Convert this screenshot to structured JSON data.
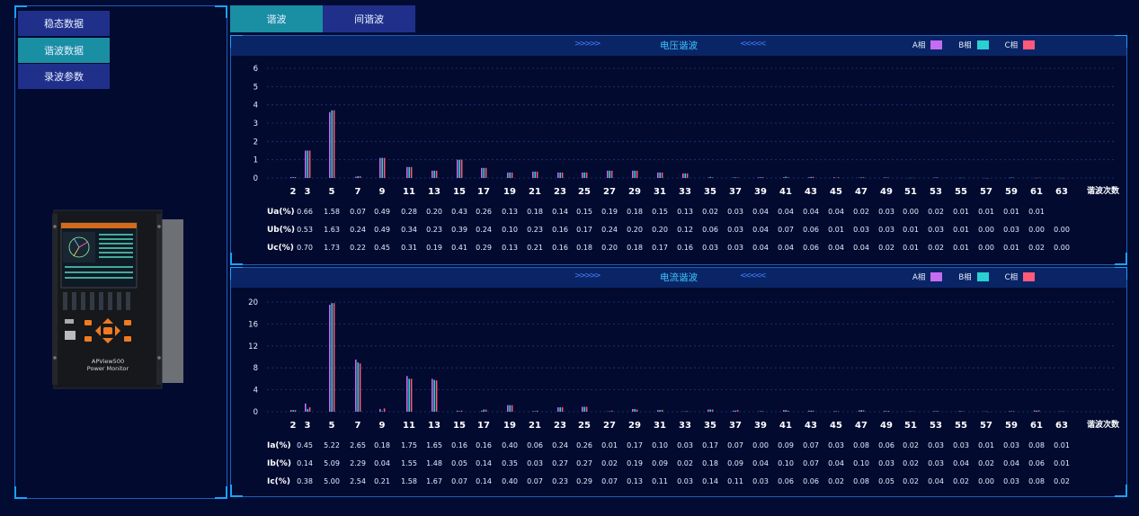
{
  "menu": {
    "items": [
      {
        "label": "稳态数据",
        "active": false
      },
      {
        "label": "谐波数据",
        "active": true
      },
      {
        "label": "录波参数",
        "active": false
      }
    ]
  },
  "device": {
    "line1": "APView500",
    "line2": "Power Monitor"
  },
  "tabs": [
    {
      "label": "谐波",
      "active": true
    },
    {
      "label": "间谐波",
      "active": false
    }
  ],
  "colors": {
    "phase_a": "#c66cf2",
    "phase_b": "#29d0d2",
    "phase_c": "#ff5a7a",
    "accent": "#3ec6ff"
  },
  "voltage": {
    "title": "电压谐波",
    "legend": [
      "A相",
      "B相",
      "C相"
    ],
    "order_label": "谐波次数",
    "rows": [
      {
        "label": "Ua(%)",
        "values": [
          "0.66",
          "1.58",
          "0.07",
          "0.49",
          "0.28",
          "0.20",
          "0.43",
          "0.26",
          "0.13",
          "0.18",
          "0.14",
          "0.15",
          "0.19",
          "0.18",
          "0.15",
          "0.13",
          "0.02",
          "0.03",
          "0.04",
          "0.04",
          "0.04",
          "0.04",
          "0.02",
          "0.03",
          "0.00",
          "0.02",
          "0.01",
          "0.01",
          "0.01",
          "0.01"
        ]
      },
      {
        "label": "Ub(%)",
        "values": [
          "0.53",
          "1.63",
          "0.24",
          "0.49",
          "0.34",
          "0.23",
          "0.39",
          "0.24",
          "0.10",
          "0.23",
          "0.16",
          "0.17",
          "0.24",
          "0.20",
          "0.20",
          "0.12",
          "0.06",
          "0.03",
          "0.04",
          "0.07",
          "0.06",
          "0.01",
          "0.03",
          "0.03",
          "0.01",
          "0.03",
          "0.01",
          "0.00",
          "0.03",
          "0.00",
          "0.00"
        ]
      },
      {
        "label": "Uc(%)",
        "values": [
          "0.70",
          "1.73",
          "0.22",
          "0.45",
          "0.31",
          "0.19",
          "0.41",
          "0.29",
          "0.13",
          "0.21",
          "0.16",
          "0.18",
          "0.20",
          "0.18",
          "0.17",
          "0.16",
          "0.03",
          "0.03",
          "0.04",
          "0.04",
          "0.06",
          "0.04",
          "0.04",
          "0.02",
          "0.01",
          "0.02",
          "0.01",
          "0.00",
          "0.01",
          "0.02",
          "0.00"
        ]
      }
    ]
  },
  "current": {
    "title": "电流谐波",
    "legend": [
      "A相",
      "B相",
      "C相"
    ],
    "order_label": "谐波次数",
    "rows": [
      {
        "label": "Ia(%)",
        "values": [
          "0.45",
          "5.22",
          "2.65",
          "0.18",
          "1.75",
          "1.65",
          "0.16",
          "0.16",
          "0.40",
          "0.06",
          "0.24",
          "0.26",
          "0.01",
          "0.17",
          "0.10",
          "0.03",
          "0.17",
          "0.07",
          "0.00",
          "0.09",
          "0.07",
          "0.03",
          "0.08",
          "0.06",
          "0.02",
          "0.03",
          "0.03",
          "0.01",
          "0.03",
          "0.08",
          "0.01"
        ]
      },
      {
        "label": "Ib(%)",
        "values": [
          "0.14",
          "5.09",
          "2.29",
          "0.04",
          "1.55",
          "1.48",
          "0.05",
          "0.14",
          "0.35",
          "0.03",
          "0.27",
          "0.27",
          "0.02",
          "0.19",
          "0.09",
          "0.02",
          "0.18",
          "0.09",
          "0.04",
          "0.10",
          "0.07",
          "0.04",
          "0.10",
          "0.03",
          "0.02",
          "0.03",
          "0.04",
          "0.02",
          "0.04",
          "0.06",
          "0.01"
        ]
      },
      {
        "label": "Ic(%)",
        "values": [
          "0.38",
          "5.00",
          "2.54",
          "0.21",
          "1.58",
          "1.67",
          "0.07",
          "0.14",
          "0.40",
          "0.07",
          "0.23",
          "0.29",
          "0.07",
          "0.13",
          "0.11",
          "0.03",
          "0.14",
          "0.11",
          "0.03",
          "0.06",
          "0.06",
          "0.02",
          "0.08",
          "0.05",
          "0.02",
          "0.04",
          "0.02",
          "0.00",
          "0.03",
          "0.08",
          "0.02"
        ]
      }
    ]
  },
  "chart_data": [
    {
      "type": "bar",
      "categories": [
        "2",
        "3",
        "5",
        "7",
        "9",
        "11",
        "13",
        "15",
        "17",
        "19",
        "21",
        "23",
        "25",
        "27",
        "29",
        "31",
        "33",
        "35",
        "37",
        "39",
        "41",
        "43",
        "45",
        "47",
        "49",
        "51",
        "53",
        "55",
        "57",
        "59",
        "61",
        "63"
      ],
      "ylim": [
        0,
        6
      ],
      "yticks": [
        0,
        1,
        2,
        3,
        4,
        5,
        6
      ],
      "series": [
        {
          "name": "A相",
          "values": [
            0.05,
            1.5,
            3.6,
            0.07,
            1.1,
            0.6,
            0.4,
            1.0,
            0.55,
            0.3,
            0.35,
            0.3,
            0.3,
            0.4,
            0.4,
            0.3,
            0.25,
            0.02,
            0.03,
            0.04,
            0.04,
            0.04,
            0.04,
            0.02,
            0.03,
            0.0,
            0.02,
            0.01,
            0.01,
            0.01,
            0.01,
            0.01
          ]
        },
        {
          "name": "B相",
          "values": [
            0.05,
            1.5,
            3.7,
            0.1,
            1.1,
            0.6,
            0.4,
            1.0,
            0.55,
            0.3,
            0.35,
            0.3,
            0.3,
            0.4,
            0.4,
            0.3,
            0.25,
            0.06,
            0.03,
            0.04,
            0.07,
            0.06,
            0.01,
            0.03,
            0.03,
            0.01,
            0.03,
            0.01,
            0.0,
            0.03,
            0.0,
            0.0
          ]
        },
        {
          "name": "C相",
          "values": [
            0.05,
            1.5,
            3.7,
            0.1,
            1.1,
            0.6,
            0.4,
            1.0,
            0.55,
            0.3,
            0.35,
            0.3,
            0.3,
            0.4,
            0.4,
            0.3,
            0.25,
            0.03,
            0.03,
            0.04,
            0.04,
            0.06,
            0.04,
            0.04,
            0.02,
            0.01,
            0.02,
            0.01,
            0.0,
            0.01,
            0.02,
            0.0
          ]
        }
      ]
    },
    {
      "type": "bar",
      "categories": [
        "2",
        "3",
        "5",
        "7",
        "9",
        "11",
        "13",
        "15",
        "17",
        "19",
        "21",
        "23",
        "25",
        "27",
        "29",
        "31",
        "33",
        "35",
        "37",
        "39",
        "41",
        "43",
        "45",
        "47",
        "49",
        "51",
        "53",
        "55",
        "57",
        "59",
        "61",
        "63"
      ],
      "ylim": [
        0,
        20
      ],
      "yticks": [
        0,
        4,
        8,
        12,
        16,
        20
      ],
      "series": [
        {
          "name": "A相",
          "values": [
            0.3,
            1.5,
            19.5,
            9.5,
            0.5,
            6.5,
            6.0,
            0.2,
            0.2,
            1.2,
            0.1,
            0.8,
            0.9,
            0.05,
            0.5,
            0.3,
            0.05,
            0.4,
            0.2,
            0.05,
            0.3,
            0.2,
            0.1,
            0.25,
            0.15,
            0.05,
            0.1,
            0.1,
            0.05,
            0.1,
            0.25,
            0.05
          ]
        },
        {
          "name": "B相",
          "values": [
            0.3,
            0.5,
            19.8,
            9.0,
            0.1,
            6.0,
            5.8,
            0.1,
            0.4,
            1.2,
            0.1,
            0.8,
            0.9,
            0.05,
            0.5,
            0.3,
            0.05,
            0.4,
            0.2,
            0.1,
            0.3,
            0.2,
            0.1,
            0.3,
            0.1,
            0.05,
            0.1,
            0.1,
            0.05,
            0.1,
            0.2,
            0.05
          ]
        },
        {
          "name": "C相",
          "values": [
            0.3,
            0.8,
            19.8,
            8.8,
            0.6,
            6.0,
            5.7,
            0.2,
            0.4,
            1.2,
            0.2,
            0.8,
            0.9,
            0.2,
            0.4,
            0.35,
            0.1,
            0.4,
            0.3,
            0.1,
            0.2,
            0.2,
            0.05,
            0.25,
            0.15,
            0.05,
            0.1,
            0.05,
            0.0,
            0.1,
            0.25,
            0.05
          ]
        }
      ]
    }
  ]
}
